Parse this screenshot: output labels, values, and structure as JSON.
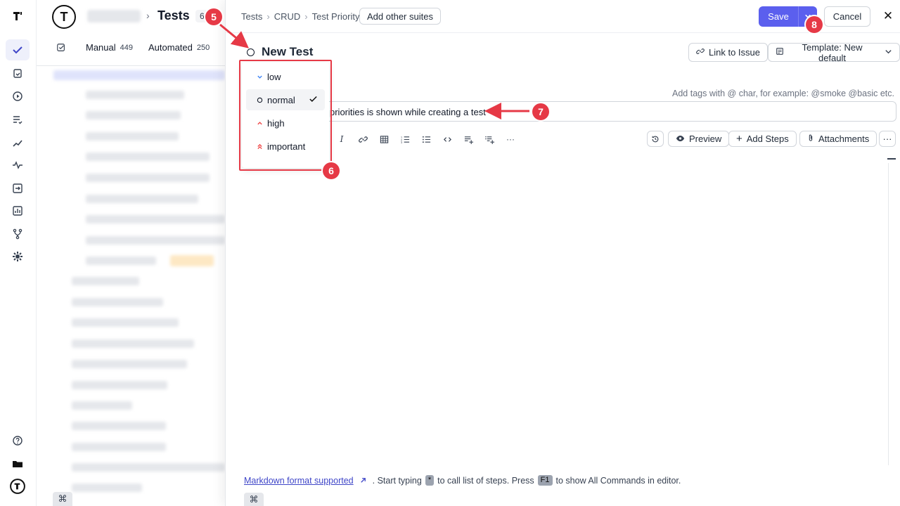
{
  "sidebar_panel": {
    "logo": "T",
    "project_name": "",
    "separator": "›",
    "title": "Tests",
    "count": "6",
    "tabs": [
      {
        "label": "Manual",
        "count": "449"
      },
      {
        "label": "Automated",
        "count": "250"
      }
    ],
    "command_key": "⌘"
  },
  "breadcrumb": {
    "items": [
      "Tests",
      "CRUD",
      "Test Priority"
    ],
    "separator": "›",
    "add_suites_label": "Add other suites"
  },
  "header_actions": {
    "save_label": "Save",
    "cancel_label": "Cancel",
    "close_symbol": "✕"
  },
  "test": {
    "name": "New Test",
    "link_issue_label": "Link to Issue",
    "template_label": "Template: New default",
    "tag_hint": "Add tags with @ char, for example: @smoke @basic etc.",
    "description": "priorities is shown while creating a test"
  },
  "editor_actions": {
    "preview_label": "Preview",
    "add_steps_label": "Add Steps",
    "attachments_label": "Attachments",
    "more_symbol": "···"
  },
  "priority_menu": {
    "options": [
      {
        "label": "low",
        "icon": "chevron-down-icon",
        "color": "#3b82f6"
      },
      {
        "label": "normal",
        "icon": "circle-icon",
        "color": "#111827",
        "selected": true
      },
      {
        "label": "high",
        "icon": "chevron-up-icon",
        "color": "#ef4444"
      },
      {
        "label": "important",
        "icon": "double-chevron-up-icon",
        "color": "#ef4444"
      }
    ]
  },
  "footer": {
    "markdown_link": "Markdown format supported",
    "text_1": ". Start typing",
    "key_1": "*",
    "text_2": "to call list of steps. Press",
    "key_2": "F1",
    "text_3": "to show All Commands in editor.",
    "command_key": "⌘"
  },
  "annotations": {
    "step_5": "5",
    "step_6": "6",
    "step_7": "7",
    "step_8": "8",
    "color": "#e63946"
  }
}
